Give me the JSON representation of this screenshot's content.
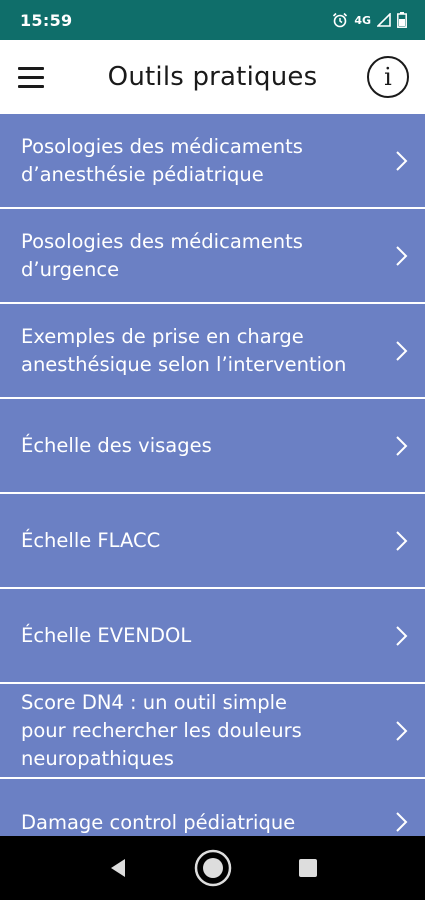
{
  "status_bar": {
    "time": "15:59",
    "network": "4G",
    "icons": [
      "alarm-icon",
      "signal-icon",
      "battery-icon"
    ]
  },
  "header": {
    "title": "Outils pratiques",
    "menu_icon": "hamburger-menu-icon",
    "info_icon": "info-icon",
    "info_glyph": "i"
  },
  "tools": [
    {
      "label": "Posologies des médicaments\nd’anesthésie pédiatrique"
    },
    {
      "label": "Posologies des médicaments\nd’urgence"
    },
    {
      "label": "Exemples de prise en charge\nanesthésique selon l’intervention"
    },
    {
      "label": "Échelle des visages"
    },
    {
      "label": "Échelle FLACC"
    },
    {
      "label": "Échelle EVENDOL"
    },
    {
      "label": "Score DN4 : un outil simple\npour rechercher les douleurs\nneuropathiques"
    },
    {
      "label": "Damage control pédiatrique"
    }
  ],
  "nav_bar": {
    "buttons": [
      "back-icon",
      "home-icon",
      "recents-icon"
    ]
  },
  "colors": {
    "status_bar": "#0f6e6a",
    "list_item": "#6b80c4",
    "text_on_item": "#ffffff",
    "nav_bar": "#000000"
  }
}
